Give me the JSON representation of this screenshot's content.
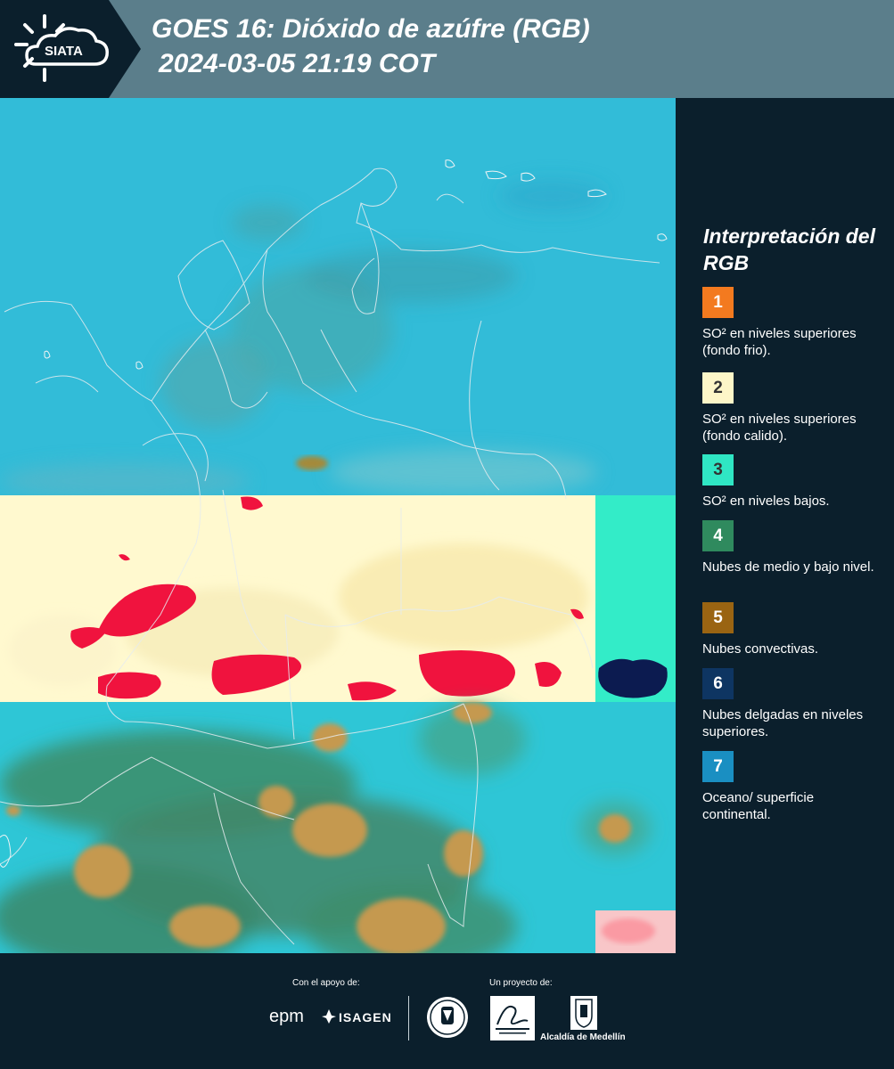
{
  "header": {
    "logo_text": "SIATA",
    "title_line1": "GOES 16: Dióxido de azúfre (RGB)",
    "title_line2": "2024-03-05 21:19 COT"
  },
  "legend": {
    "title": "Interpretación del RGB",
    "items": [
      {
        "number": "1",
        "color": "#f37a1f",
        "text_color": "#ffffff",
        "label": "SO² en niveles superiores (fondo frio)."
      },
      {
        "number": "2",
        "color": "#fdf6c8",
        "text_color": "#333333",
        "label": "SO² en niveles superiores (fondo calido)."
      },
      {
        "number": "3",
        "color": "#2fe6c4",
        "text_color": "#333333",
        "label": "SO² en niveles bajos."
      },
      {
        "number": "4",
        "color": "#2f8a5e",
        "text_color": "#ffffff",
        "label": "Nubes de medio y bajo nivel."
      },
      {
        "number": "5",
        "color": "#9a6412",
        "text_color": "#ffffff",
        "label": "Nubes convectivas."
      },
      {
        "number": "6",
        "color": "#0e3562",
        "text_color": "#ffffff",
        "label": "Nubes delgadas en niveles superiores."
      },
      {
        "number": "7",
        "color": "#1a8fc2",
        "text_color": "#ffffff",
        "label": "Oceano/ superficie continental."
      }
    ]
  },
  "footer": {
    "support_label": "Con el apoyo de:",
    "project_label": "Un proyecto de:",
    "sponsor_epm": "epm",
    "sponsor_isagen": "ISAGEN",
    "medellin_label": "Alcaldía de Medellín"
  },
  "colors": {
    "header_bg": "#5b7e8b",
    "panel_bg": "#0b1f2c",
    "ocean": "#2fb8d6",
    "warm_band": "#fff8cc",
    "so2_red": "#f0163f",
    "convective": "#c39a52",
    "mid_cloud": "#3f8e6a"
  }
}
